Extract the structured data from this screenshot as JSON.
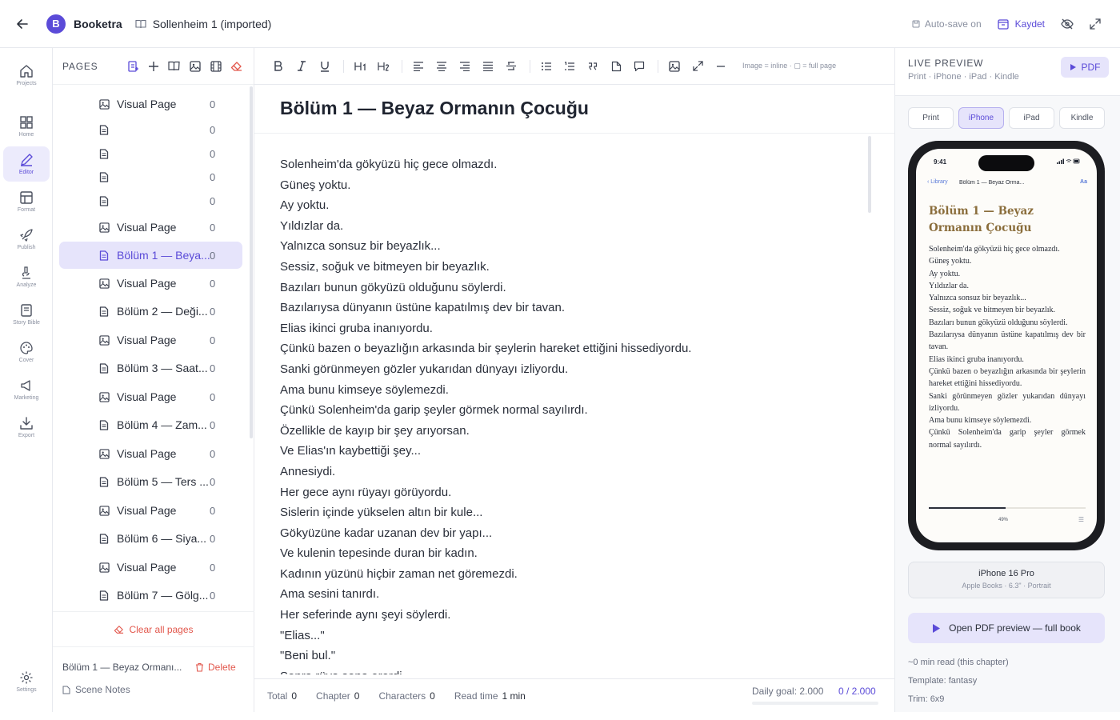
{
  "topbar": {
    "brand": "Booketra",
    "logo_letter": "B",
    "book_title": "Sollenheim 1 (imported)",
    "autosave": "Auto-save on",
    "save": "Kaydet"
  },
  "rail": [
    {
      "label": "Projects",
      "icon": "home-icon"
    },
    {
      "label": "Home",
      "icon": "grid-icon"
    },
    {
      "label": "Editor",
      "icon": "pen-icon"
    },
    {
      "label": "Format",
      "icon": "layout-icon"
    },
    {
      "label": "Publish",
      "icon": "rocket-icon"
    },
    {
      "label": "Analyze",
      "icon": "microscope-icon"
    },
    {
      "label": "Story Bible",
      "icon": "notebook-icon"
    },
    {
      "label": "Cover",
      "icon": "palette-icon"
    },
    {
      "label": "Marketing",
      "icon": "megaphone-icon"
    },
    {
      "label": "Export",
      "icon": "download-icon"
    },
    {
      "label": "Settings",
      "icon": "gear-icon"
    }
  ],
  "pages": {
    "title": "PAGES",
    "items": [
      {
        "label": "Visual Page",
        "type": "image",
        "count": "0"
      },
      {
        "label": "",
        "type": "doc",
        "count": "0"
      },
      {
        "label": "",
        "type": "doc",
        "count": "0"
      },
      {
        "label": "",
        "type": "doc",
        "count": "0"
      },
      {
        "label": "",
        "type": "doc",
        "count": "0"
      },
      {
        "label": "Visual Page",
        "type": "image",
        "count": "0"
      },
      {
        "label": "Bölüm 1 — Beya...",
        "type": "doc",
        "count": "0",
        "selected": true
      },
      {
        "label": "Visual Page",
        "type": "image",
        "count": "0"
      },
      {
        "label": "Bölüm 2 — Deği...",
        "type": "doc",
        "count": "0"
      },
      {
        "label": "Visual Page",
        "type": "image",
        "count": "0"
      },
      {
        "label": "Bölüm 3 — Saat...",
        "type": "doc",
        "count": "0"
      },
      {
        "label": "Visual Page",
        "type": "image",
        "count": "0"
      },
      {
        "label": "Bölüm 4 — Zam...",
        "type": "doc",
        "count": "0"
      },
      {
        "label": "Visual Page",
        "type": "image",
        "count": "0"
      },
      {
        "label": "Bölüm 5 — Ters ...",
        "type": "doc",
        "count": "0"
      },
      {
        "label": "Visual Page",
        "type": "image",
        "count": "0"
      },
      {
        "label": "Bölüm 6 — Siya...",
        "type": "doc",
        "count": "0"
      },
      {
        "label": "Visual Page",
        "type": "image",
        "count": "0"
      },
      {
        "label": "Bölüm 7 — Gölg...",
        "type": "doc",
        "count": "0"
      }
    ],
    "clear": "Clear all pages",
    "footer_title": "Bölüm 1 — Beyaz Ormanı...",
    "delete": "Delete",
    "scene_notes": "Scene Notes"
  },
  "editor": {
    "toolbar_hint": "Image = inline · ▢ = full page",
    "chapter_title": "Bölüm 1 — Beyaz Ormanın Çocuğu",
    "lines": [
      "Solenheim'da gökyüzü hiç gece olmazdı.",
      "Güneş yoktu.",
      "Ay yoktu.",
      "Yıldızlar da.",
      "Yalnızca sonsuz bir beyazlık...",
      "Sessiz, soğuk ve bitmeyen bir beyazlık.",
      "Bazıları bunun gökyüzü olduğunu söylerdi.",
      "Bazılarıysa dünyanın üstüne kapatılmış dev bir tavan.",
      "Elias ikinci gruba inanıyordu.",
      "Çünkü bazen o beyazlığın arkasında bir şeylerin hareket ettiğini hissediyordu.",
      "Sanki görünmeyen gözler yukarıdan dünyayı izliyordu.",
      "Ama bunu kimseye söylemezdi.",
      "Çünkü Solenheim'da garip şeyler görmek normal sayılırdı.",
      "Özellikle de kayıp bir şey arıyorsan.",
      "Ve Elias'ın kaybettiği şey...",
      "Annesiydi.",
      "Her gece aynı rüyayı görüyordu.",
      "Sislerin içinde yükselen altın bir kule...",
      "Gökyüzüne kadar uzanan dev bir yapı...",
      "Ve kulenin tepesinde duran bir kadın.",
      "Kadının yüzünü hiçbir zaman net göremezdi.",
      "Ama sesini tanırdı.",
      "Her seferinde aynı şeyi söylerdi.",
      "\"Elias...\"",
      "\"Beni bul.\"",
      "Sonra rüya sona ererdi."
    ],
    "status": {
      "total_label": "Total",
      "total": "0",
      "chapter_label": "Chapter",
      "chapter": "0",
      "chars_label": "Characters",
      "chars": "0",
      "read_label": "Read time",
      "read": "1 min",
      "goal": "Daily goal: 2.000",
      "goal_value": "0 / 2.000"
    }
  },
  "preview": {
    "title": "LIVE PREVIEW",
    "subtitle": "Print · iPhone · iPad · Kindle",
    "pdf": "PDF",
    "devices": [
      "Print",
      "iPhone",
      "iPad",
      "Kindle"
    ],
    "active_device": "iPhone",
    "phone": {
      "time": "9:41",
      "back": "‹ Library",
      "chapter": "Bölüm 1 — Beyaz Orma...",
      "aa": "Aa",
      "title": "Bölüm 1 — Beyaz Ormanın Çocuğu",
      "lines": [
        "Solenheim'da gökyüzü hiç gece olmazdı.",
        "Güneş yoktu.",
        "Ay yoktu.",
        "Yıldızlar da.",
        "Yalnızca sonsuz bir beyazlık...",
        "Sessiz, soğuk ve bitmeyen bir beyazlık.",
        "Bazıları bunun gökyüzü olduğunu söylerdi.",
        "Bazılarıysa dünyanın üstüne kapatılmış dev bir tavan.",
        "Elias ikinci gruba inanıyordu.",
        "Çünkü bazen o beyazlığın arkasında bir şeylerin hareket ettiğini hissediyordu.",
        "Sanki görünmeyen gözler yukarıdan dünyayı izliyordu.",
        "Ama bunu kimseye söylemezdi.",
        "Çünkü Solenheim'da garip şeyler görmek normal sayılırdı."
      ],
      "progress_pct": "49%",
      "progress": 0.49
    },
    "device_name": "iPhone 16 Pro",
    "device_meta": "Apple Books · 6.3\" · Portrait",
    "open_pdf": "Open PDF preview — full book",
    "read_time": "~0 min read (this chapter)",
    "template": "Template: fantasy",
    "trim": "Trim: 6x9"
  },
  "colors": {
    "accent": "#5b4bd8",
    "danger": "#e2574c",
    "title_gold": "#8a6d3b"
  }
}
